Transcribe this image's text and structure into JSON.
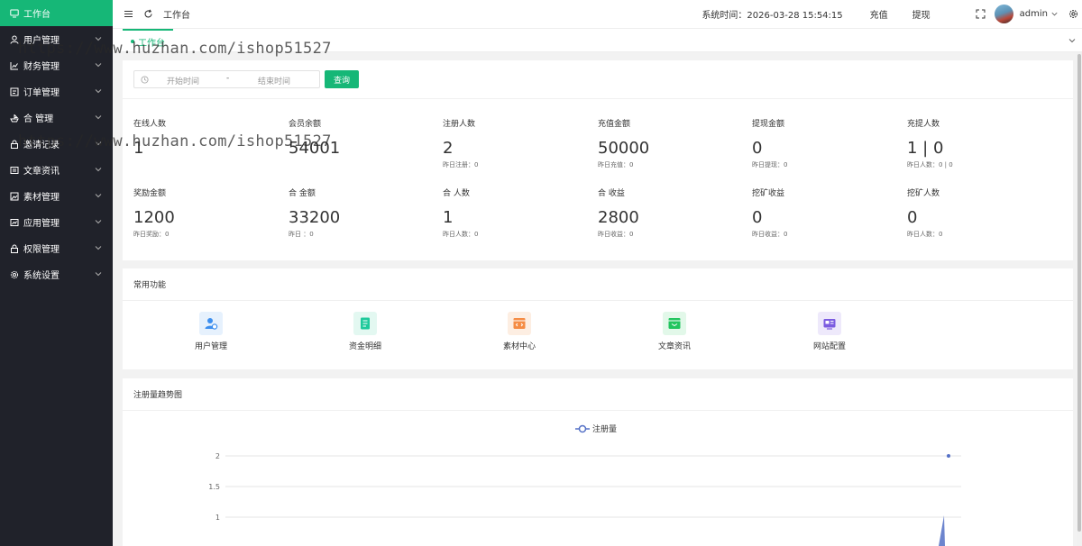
{
  "sidebar": {
    "items": [
      {
        "label": "工作台",
        "icon": "monitor-icon",
        "active": true
      },
      {
        "label": "用户管理",
        "icon": "user-icon"
      },
      {
        "label": "财务管理",
        "icon": "chart-icon"
      },
      {
        "label": "订单管理",
        "icon": "order-icon"
      },
      {
        "label": "合 管理",
        "icon": "ship-icon"
      },
      {
        "label": "邀请记录",
        "icon": "lock-icon"
      },
      {
        "label": "文章资讯",
        "icon": "news-icon"
      },
      {
        "label": "素材管理",
        "icon": "image-icon"
      },
      {
        "label": "应用管理",
        "icon": "app-icon"
      },
      {
        "label": "权限管理",
        "icon": "lock-icon"
      },
      {
        "label": "系统设置",
        "icon": "gear-icon"
      }
    ]
  },
  "header": {
    "title": "工作台",
    "system_time": "系统时间：2026-03-28 15:54:15",
    "recharge": "充值",
    "withdraw": "提现",
    "user": "admin"
  },
  "tabs": [
    {
      "label": "工作台"
    }
  ],
  "filter": {
    "start_placeholder": "开始时间",
    "end_placeholder": "结束时间",
    "separator": "-",
    "query_label": "查询"
  },
  "stats": [
    {
      "label": "在线人数",
      "value": "1",
      "sub": ""
    },
    {
      "label": "会员余额",
      "value": "54001",
      "sub": ""
    },
    {
      "label": "注册人数",
      "value": "2",
      "sub": "昨日注册：0"
    },
    {
      "label": "充值金额",
      "value": "50000",
      "sub": "昨日充值：0"
    },
    {
      "label": "提现金额",
      "value": "0",
      "sub": "昨日提现：0"
    },
    {
      "label": "充提人数",
      "value": "1 | 0",
      "sub": "昨日人数：0 | 0"
    },
    {
      "label": "奖励金额",
      "value": "1200",
      "sub": "昨日奖励：0"
    },
    {
      "label": "合 金额",
      "value": "33200",
      "sub": "昨日 ：0"
    },
    {
      "label": "合 人数",
      "value": "1",
      "sub": "昨日人数：0"
    },
    {
      "label": "合 收益",
      "value": "2800",
      "sub": "昨日收益：0"
    },
    {
      "label": "挖矿收益",
      "value": "0",
      "sub": "昨日收益：0"
    },
    {
      "label": "挖矿人数",
      "value": "0",
      "sub": "昨日人数：0"
    }
  ],
  "shortcuts": {
    "title": "常用功能",
    "items": [
      {
        "label": "用户管理",
        "icon": "user-manage-icon",
        "color": "#3d8fef"
      },
      {
        "label": "资金明细",
        "icon": "ledger-icon",
        "color": "#1fc99b"
      },
      {
        "label": "素材中心",
        "icon": "code-box-icon",
        "color": "#f58c44"
      },
      {
        "label": "文章资讯",
        "icon": "inbox-icon",
        "color": "#22c55e"
      },
      {
        "label": "网站配置",
        "icon": "config-card-icon",
        "color": "#7c5ce0"
      }
    ]
  },
  "watermark": "https://www.huzhan.com/ishop51527",
  "chart_data": {
    "title": "注册量趋势图",
    "type": "line",
    "legend": [
      "注册量"
    ],
    "y_ticks": [
      "2",
      "1.5",
      "1"
    ],
    "ylim": [
      0,
      2
    ],
    "series": [
      {
        "name": "注册量",
        "color": "#5470c6"
      }
    ],
    "last_point": {
      "y": 2
    }
  }
}
